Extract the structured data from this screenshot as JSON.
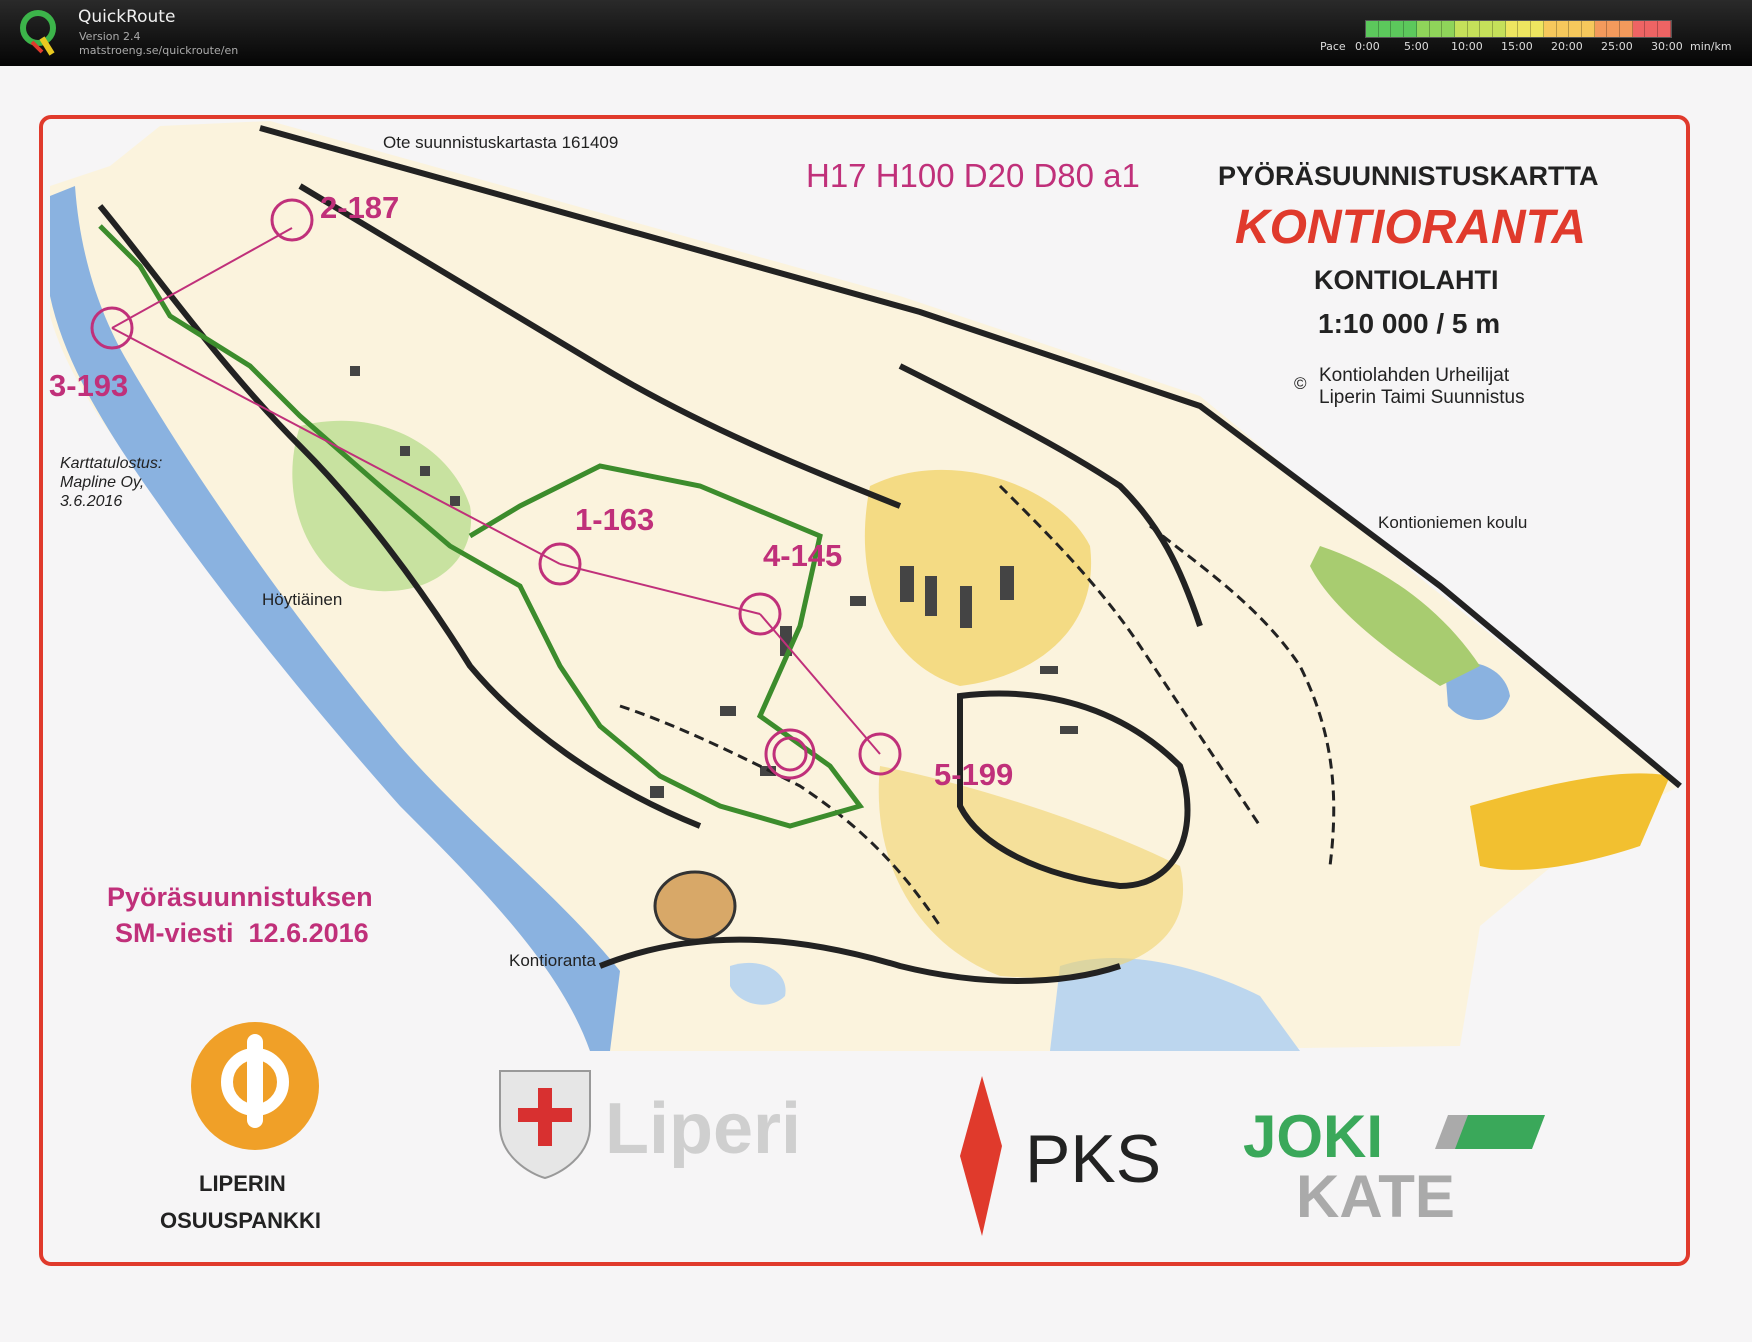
{
  "app": {
    "name": "QuickRoute",
    "version": "Version 2.4",
    "url": "matstroeng.se/quickroute/en"
  },
  "pace_legend": {
    "label": "Pace",
    "ticks": [
      "0:00",
      "5:00",
      "10:00",
      "15:00",
      "20:00",
      "25:00",
      "30:00"
    ],
    "unit": "min/km",
    "colors": [
      "#5cc85c",
      "#8fd45a",
      "#c5e05a",
      "#eee560",
      "#f6c85c",
      "#f39a5c",
      "#ee6464"
    ]
  },
  "map": {
    "extract_note": "Ote suunnistuskartasta 161409",
    "classes": "H17 H100 D20 D80  a1",
    "map_type": "PYÖRÄSUUNNISTUSKARTTA",
    "title": "KONTIORANTA",
    "municipality": "KONTIOLAHTI",
    "scale": "1:10 000 / 5 m",
    "copyright_symbol": "©",
    "copyright_line1": "Kontiolahden Urheilijat",
    "copyright_line2": "Liperin Taimi Suunnistus",
    "print_line1": "Karttatulostus:",
    "print_line2": "Mapline Oy,",
    "print_line3": "3.6.2016",
    "places": {
      "lake": "Höytiäinen",
      "village": "Kontioranta",
      "school": "Kontioniemen koulu"
    },
    "controls": [
      "2-187",
      "3-193",
      "1-163",
      "4-145",
      "5-199"
    ],
    "event_line1": "Pyöräsuunnistuksen",
    "event_line2": "SM-viesti  12.6.2016",
    "colors": {
      "border": "#e03a2c",
      "course": "#c0307a",
      "route": "#3c8c2c",
      "forest_yellow": "#f2d46e",
      "water": "#8ab2e0",
      "green": "#c8e2a0"
    }
  },
  "sponsors": {
    "op_line1": "LIPERIN",
    "op_line2": "OSUUSPANKKI",
    "liperi": "Liperi",
    "pks": "PKS",
    "joki": "JOKI",
    "kate": "KATE"
  }
}
